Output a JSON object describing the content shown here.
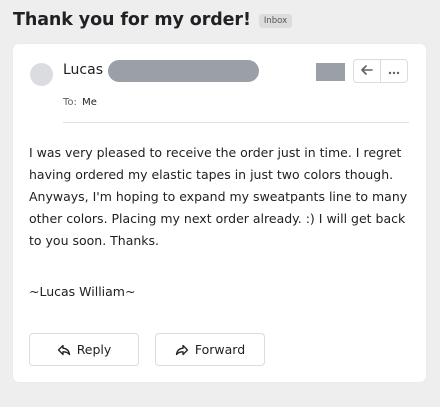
{
  "subject": "Thank you for my order!",
  "label": "Inbox",
  "sender": {
    "name": "Lucas"
  },
  "recipient": {
    "prefix": "To:",
    "name": "Me"
  },
  "body": {
    "message": "I was very pleased to receive the order just in time. I regret having ordered my elastic tapes in just two colors though. Anyways, I'm hoping to expand my sweatpants line to many other colors. Placing my next order already. :) I will get back to you soon. Thanks.",
    "signature": "~Lucas William~"
  },
  "actions": {
    "reply_label": "Reply",
    "forward_label": "Forward"
  },
  "icons": {
    "reply": "reply-icon",
    "more": "more-horizontal-icon",
    "forward": "forward-icon"
  },
  "colors": {
    "background": "#eeeeee",
    "card": "#ffffff",
    "redaction": "#9aa0a6",
    "avatar": "#dadce0"
  }
}
